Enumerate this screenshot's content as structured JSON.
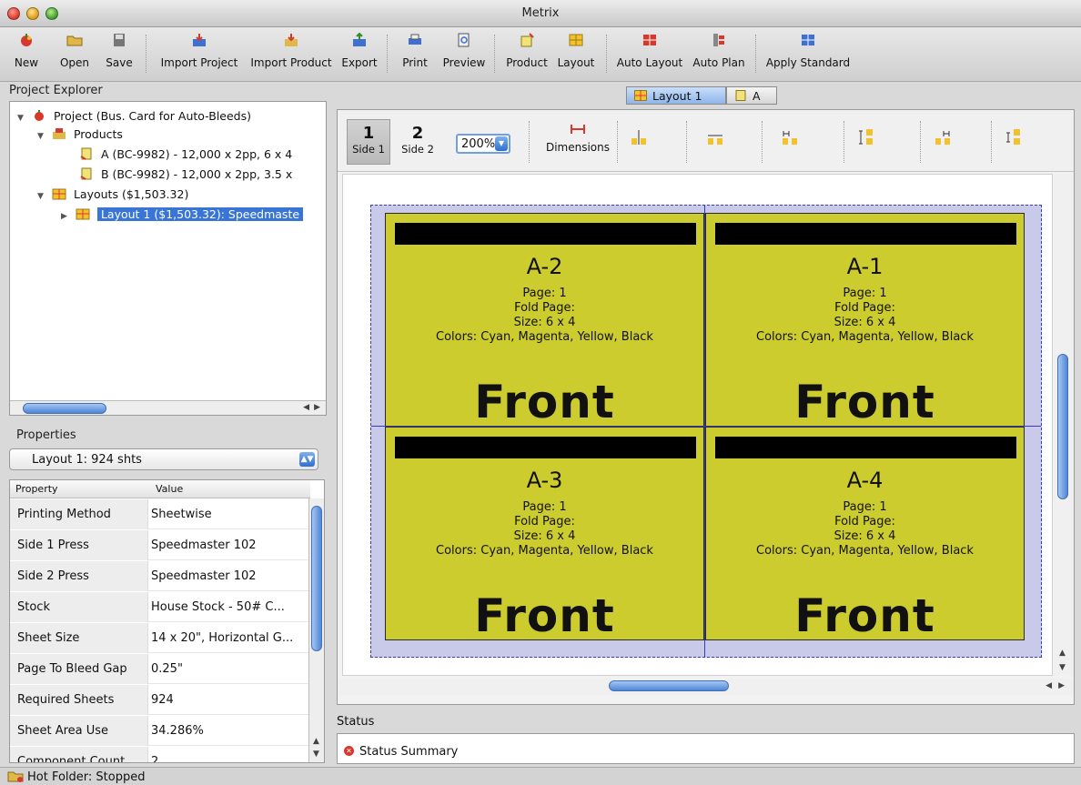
{
  "window": {
    "title": "Metrix"
  },
  "toolbar": {
    "new": "New",
    "open": "Open",
    "save": "Save",
    "import_project": "Import Project",
    "import_product": "Import Product",
    "export": "Export",
    "print": "Print",
    "preview": "Preview",
    "product": "Product",
    "layout": "Layout",
    "auto_layout": "Auto Layout",
    "auto_plan": "Auto Plan",
    "apply_standard": "Apply Standard"
  },
  "explorer": {
    "title": "Project Explorer",
    "project": "Project  (Bus. Card for Auto-Bleeds)",
    "products": "Products",
    "product_a": "A (BC-9982) - 12,000 x 2pp, 6 x 4",
    "product_b": "B (BC-9982) - 12,000 x 2pp, 3.5 x",
    "layouts": "Layouts ($1,503.32)",
    "layout_1": "Layout 1 ($1,503.32): Speedmaste"
  },
  "properties": {
    "title": "Properties",
    "selected": "Layout 1: 924 shts",
    "col_property": "Property",
    "col_value": "Value",
    "rows": [
      {
        "k": "Printing Method",
        "v": "Sheetwise"
      },
      {
        "k": "Side 1 Press",
        "v": "Speedmaster 102"
      },
      {
        "k": "Side 2 Press",
        "v": "Speedmaster 102"
      },
      {
        "k": "Stock",
        "v": "House Stock - 50# C..."
      },
      {
        "k": "Sheet Size",
        "v": "14 x 20\", Horizontal G..."
      },
      {
        "k": "Page To Bleed Gap",
        "v": "0.25\""
      },
      {
        "k": "Required Sheets",
        "v": "924"
      },
      {
        "k": "Sheet Area Use",
        "v": "34.286%"
      },
      {
        "k": "Component Count",
        "v": "2"
      }
    ]
  },
  "tabs": {
    "layout1": "Layout 1",
    "a": "A"
  },
  "canvas_toolbar": {
    "side1_num": "1",
    "side1": "Side 1",
    "side2_num": "2",
    "side2": "Side 2",
    "zoom": "200%",
    "dimensions": "Dimensions"
  },
  "cards": [
    {
      "id": "A-2",
      "page": "Page: 1",
      "fold": "Fold Page:",
      "size": "Size: 6 x 4",
      "colors": "Colors: Cyan, Magenta, Yellow, Black",
      "side": "Front"
    },
    {
      "id": "A-1",
      "page": "Page: 1",
      "fold": "Fold Page:",
      "size": "Size: 6 x 4",
      "colors": "Colors: Cyan, Magenta, Yellow, Black",
      "side": "Front"
    },
    {
      "id": "A-3",
      "page": "Page: 1",
      "fold": "Fold Page:",
      "size": "Size: 6 x 4",
      "colors": "Colors: Cyan, Magenta, Yellow, Black",
      "side": "Front"
    },
    {
      "id": "A-4",
      "page": "Page: 1",
      "fold": "Fold Page:",
      "size": "Size: 6 x 4",
      "colors": "Colors: Cyan, Magenta, Yellow, Black",
      "side": "Front"
    }
  ],
  "status": {
    "title": "Status",
    "summary": "Status Summary"
  },
  "hot_folder": "Hot Folder: Stopped",
  "colors": {
    "card": "#cdcc2e",
    "sheet": "#c9c9ea",
    "selection": "#3875d7",
    "scroll_thumb": "#4d86d8"
  }
}
